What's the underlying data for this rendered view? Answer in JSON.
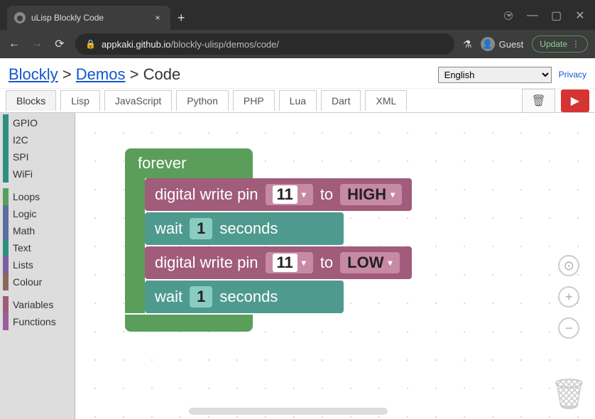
{
  "browser": {
    "tab_title": "uLisp Blockly Code",
    "new_tab": "+",
    "close": "×",
    "back": "←",
    "forward": "→",
    "reload": "⟳",
    "url_domain": "appkaki.github.io",
    "url_path": "/blockly-ulisp/demos/code/",
    "guest": "Guest",
    "update": "Update",
    "win_min": "—",
    "win_max": "▢",
    "win_close": "✕",
    "menu": "⋮"
  },
  "breadcrumb": {
    "blockly": "Blockly",
    "demos": "Demos",
    "code": "Code",
    "sep": ">"
  },
  "language": "English",
  "privacy": "Privacy",
  "code_tabs": {
    "blocks": "Blocks",
    "lisp": "Lisp",
    "javascript": "JavaScript",
    "python": "Python",
    "php": "PHP",
    "lua": "Lua",
    "dart": "Dart",
    "xml": "XML"
  },
  "toolbox": {
    "gpio": "GPIO",
    "i2c": "I2C",
    "spi": "SPI",
    "wifi": "WiFi",
    "loops": "Loops",
    "logic": "Logic",
    "math": "Math",
    "text": "Text",
    "lists": "Lists",
    "colour": "Colour",
    "variables": "Variables",
    "functions": "Functions"
  },
  "toolbox_colors": {
    "gpio": "#2f8f7f",
    "i2c": "#2f8f7f",
    "spi": "#2f8f7f",
    "wifi": "#2f8f7f",
    "loops": "#5b9e5b",
    "logic": "#5b6fa1",
    "math": "#5b6fa1",
    "text": "#2f8f7f",
    "lists": "#7a5fa1",
    "colour": "#8a6a5a",
    "variables": "#a05c7a",
    "functions": "#9a5f9a"
  },
  "blocks": {
    "forever": "forever",
    "digital_write_pin": "digital write pin",
    "to": "to",
    "wait": "wait",
    "seconds": "seconds",
    "pin": "11",
    "high": "HIGH",
    "low": "LOW",
    "wait_val": "1",
    "dropdown": "▾"
  },
  "controls": {
    "target": "⊙",
    "plus": "+",
    "minus": "−",
    "trash": "🗑",
    "run": "▶"
  }
}
